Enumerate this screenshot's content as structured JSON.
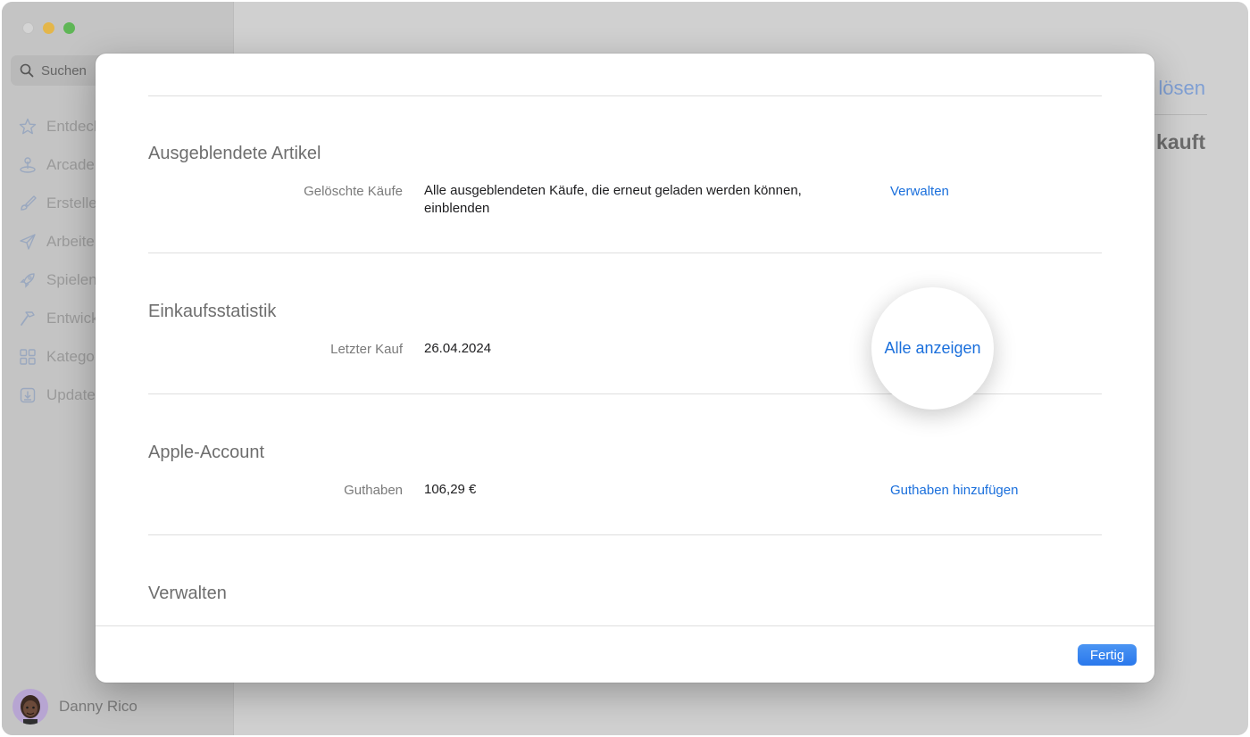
{
  "sidebar": {
    "search_placeholder": "Suchen",
    "items": [
      {
        "label": "Entdecken",
        "icon": "star-icon"
      },
      {
        "label": "Arcade",
        "icon": "joystick-icon"
      },
      {
        "label": "Erstellen",
        "icon": "brush-icon"
      },
      {
        "label": "Arbeiten",
        "icon": "paperplane-icon"
      },
      {
        "label": "Spielen",
        "icon": "rocket-icon"
      },
      {
        "label": "Entwickeln",
        "icon": "hammer-icon"
      },
      {
        "label": "Kategorien",
        "icon": "grid-icon"
      },
      {
        "label": "Updates",
        "icon": "download-icon"
      }
    ],
    "user_name": "Danny Rico"
  },
  "background_main": {
    "link_text": "lösen",
    "heading_text": "kauft"
  },
  "sheet": {
    "sections": [
      {
        "title": "Ausgeblendete Artikel",
        "label": "Gelöschte Käufe",
        "value": "Alle ausgeblendeten Käufe, die erneut geladen werden können, einblenden",
        "action": "Verwalten"
      },
      {
        "title": "Einkaufsstatistik",
        "label": "Letzter Kauf",
        "value": "26.04.2024",
        "action": "Alle anzeigen"
      },
      {
        "title": "Apple-Account",
        "label": "Guthaben",
        "value": "106,29 €",
        "action": "Guthaben hinzufügen"
      },
      {
        "title": "Verwalten"
      }
    ],
    "done_label": "Fertig"
  },
  "colors": {
    "accent": "#1a6fdc",
    "button": "#2f7cee"
  }
}
